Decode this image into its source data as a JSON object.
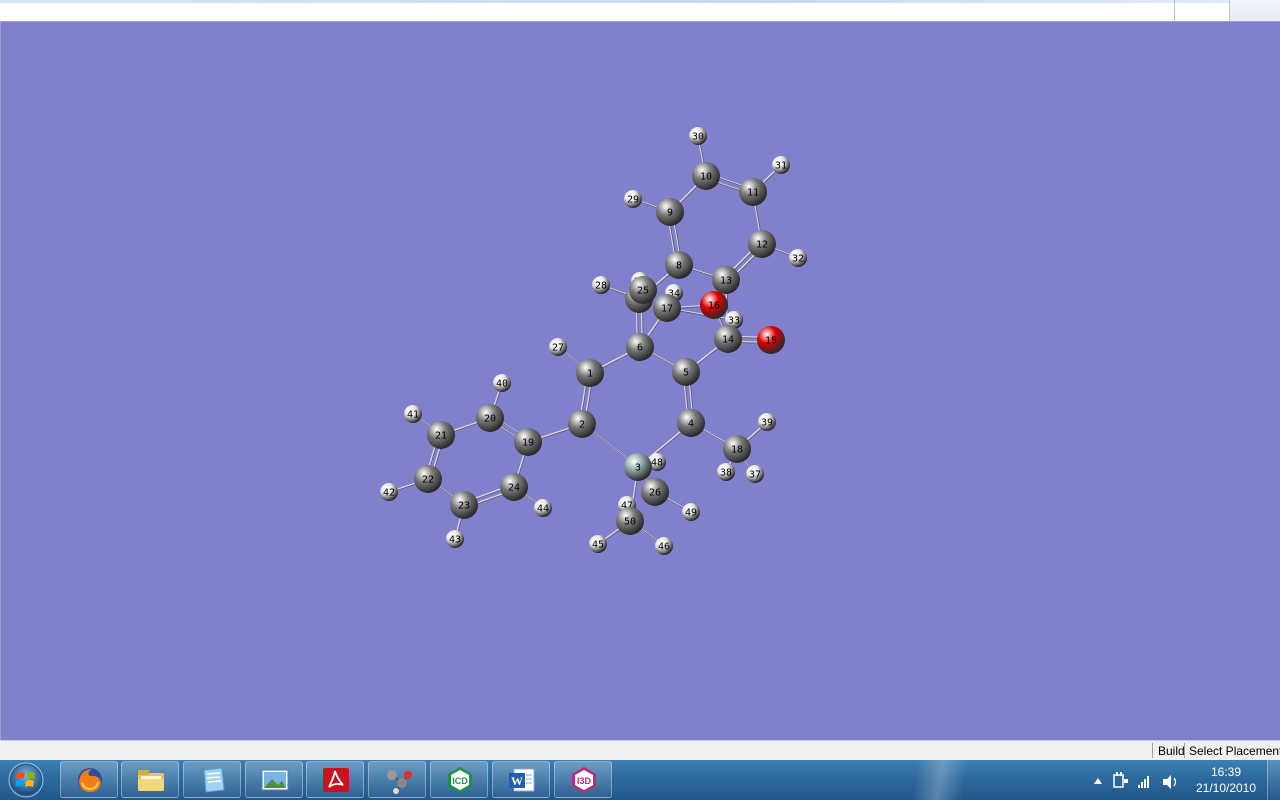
{
  "statusbar": {
    "items": [
      "Build",
      "Select Placement"
    ]
  },
  "taskbar": {
    "pinned": [
      {
        "name": "firefox-icon"
      },
      {
        "name": "folder-icon"
      },
      {
        "name": "notes-icon"
      },
      {
        "name": "picture-viewer-icon"
      },
      {
        "name": "pdf-reader-icon"
      },
      {
        "name": "molecule-viewer-icon"
      },
      {
        "name": "icd-app-icon"
      },
      {
        "name": "word-icon"
      },
      {
        "name": "i3d-app-icon"
      }
    ],
    "clock": {
      "time": "16:39",
      "date": "21/10/2010"
    }
  },
  "colors": {
    "background": "#8080cc",
    "carbon": "#7a7a7a",
    "hydrogen": "#e6e6e6",
    "oxygen": "#e00000",
    "silicon": "#8fa8a8",
    "bond": "#d9d9d9"
  },
  "molecule": {
    "atoms": [
      {
        "id": "1",
        "el": "C"
      },
      {
        "id": "2",
        "el": "C"
      },
      {
        "id": "3",
        "el": "Si"
      },
      {
        "id": "4",
        "el": "C"
      },
      {
        "id": "5",
        "el": "C"
      },
      {
        "id": "6",
        "el": "C"
      },
      {
        "id": "7",
        "el": "C"
      },
      {
        "id": "8",
        "el": "C"
      },
      {
        "id": "9",
        "el": "C"
      },
      {
        "id": "10",
        "el": "C"
      },
      {
        "id": "11",
        "el": "C"
      },
      {
        "id": "12",
        "el": "C"
      },
      {
        "id": "13",
        "el": "C"
      },
      {
        "id": "14",
        "el": "C"
      },
      {
        "id": "15",
        "el": "O"
      },
      {
        "id": "16",
        "el": "O"
      },
      {
        "id": "17",
        "el": "C"
      },
      {
        "id": "18",
        "el": "C"
      },
      {
        "id": "19",
        "el": "C"
      },
      {
        "id": "20",
        "el": "C"
      },
      {
        "id": "21",
        "el": "C"
      },
      {
        "id": "22",
        "el": "C"
      },
      {
        "id": "23",
        "el": "C"
      },
      {
        "id": "24",
        "el": "C"
      },
      {
        "id": "25",
        "el": "C"
      },
      {
        "id": "26",
        "el": "C"
      },
      {
        "id": "27",
        "el": "H"
      },
      {
        "id": "28",
        "el": "H"
      },
      {
        "id": "29",
        "el": "H"
      },
      {
        "id": "30",
        "el": "H"
      },
      {
        "id": "31",
        "el": "H"
      },
      {
        "id": "32",
        "el": "H"
      },
      {
        "id": "33",
        "el": "H"
      },
      {
        "id": "34",
        "el": "H"
      },
      {
        "id": "35",
        "el": "H"
      },
      {
        "id": "37",
        "el": "H"
      },
      {
        "id": "38",
        "el": "H"
      },
      {
        "id": "39",
        "el": "H"
      },
      {
        "id": "40",
        "el": "H"
      },
      {
        "id": "41",
        "el": "H"
      },
      {
        "id": "42",
        "el": "H"
      },
      {
        "id": "43",
        "el": "H"
      },
      {
        "id": "44",
        "el": "H"
      },
      {
        "id": "45",
        "el": "H"
      },
      {
        "id": "46",
        "el": "H"
      },
      {
        "id": "47",
        "el": "H"
      },
      {
        "id": "48",
        "el": "H"
      },
      {
        "id": "49",
        "el": "H"
      },
      {
        "id": "50",
        "el": "C"
      }
    ],
    "bonds": [
      [
        "1",
        "2",
        2
      ],
      [
        "2",
        "3",
        1
      ],
      [
        "3",
        "4",
        1
      ],
      [
        "4",
        "5",
        2
      ],
      [
        "5",
        "6",
        1
      ],
      [
        "6",
        "1",
        1
      ],
      [
        "6",
        "7",
        2
      ],
      [
        "7",
        "8",
        1
      ],
      [
        "8",
        "9",
        2
      ],
      [
        "9",
        "10",
        1
      ],
      [
        "10",
        "11",
        2
      ],
      [
        "11",
        "12",
        1
      ],
      [
        "12",
        "13",
        2
      ],
      [
        "13",
        "8",
        1
      ],
      [
        "13",
        "14",
        1
      ],
      [
        "14",
        "15",
        2
      ],
      [
        "14",
        "16",
        1
      ],
      [
        "16",
        "17",
        1
      ],
      [
        "17",
        "6",
        1
      ],
      [
        "5",
        "14",
        1
      ],
      [
        "4",
        "18",
        1
      ],
      [
        "18",
        "37",
        1
      ],
      [
        "18",
        "38",
        1
      ],
      [
        "18",
        "39",
        1
      ],
      [
        "2",
        "19",
        1
      ],
      [
        "19",
        "20",
        2
      ],
      [
        "20",
        "21",
        1
      ],
      [
        "21",
        "22",
        2
      ],
      [
        "22",
        "23",
        1
      ],
      [
        "23",
        "24",
        2
      ],
      [
        "24",
        "19",
        1
      ],
      [
        "3",
        "26",
        1
      ],
      [
        "3",
        "50",
        1
      ],
      [
        "3",
        "48",
        1
      ],
      [
        "26",
        "49",
        1
      ],
      [
        "50",
        "45",
        1
      ],
      [
        "50",
        "46",
        1
      ],
      [
        "50",
        "47",
        1
      ],
      [
        "1",
        "27",
        1
      ],
      [
        "7",
        "28",
        1
      ],
      [
        "9",
        "29",
        1
      ],
      [
        "10",
        "30",
        1
      ],
      [
        "11",
        "31",
        1
      ],
      [
        "12",
        "32",
        1
      ],
      [
        "17",
        "33",
        1
      ],
      [
        "17",
        "34",
        1
      ],
      [
        "7",
        "35",
        1
      ],
      [
        "20",
        "40",
        1
      ],
      [
        "21",
        "41",
        1
      ],
      [
        "22",
        "42",
        1
      ],
      [
        "23",
        "43",
        1
      ],
      [
        "24",
        "44",
        1
      ]
    ]
  }
}
